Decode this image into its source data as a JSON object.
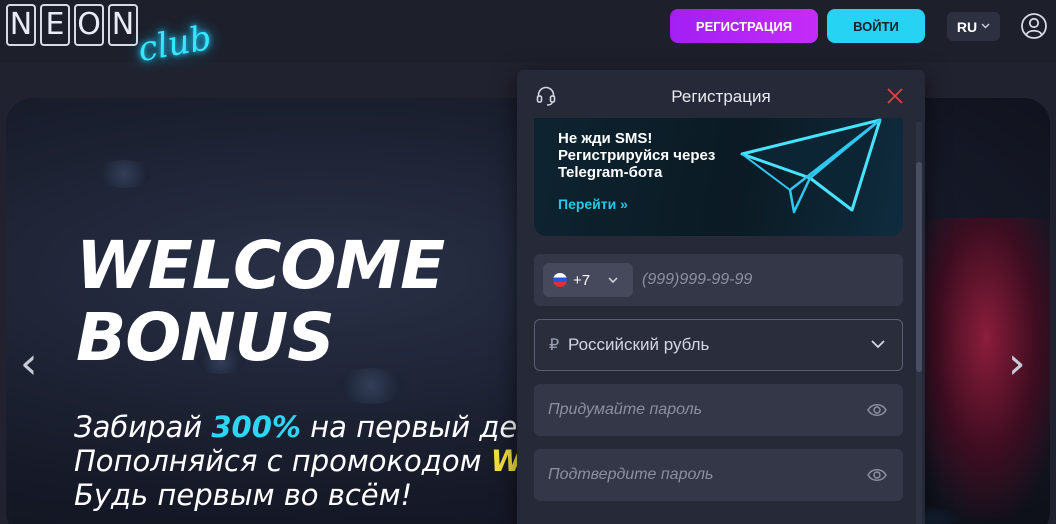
{
  "header": {
    "logo": {
      "neon": [
        "N",
        "E",
        "O",
        "N"
      ],
      "club": "club"
    },
    "register_label": "РЕГИСТРАЦИЯ",
    "login_label": "ВОЙТИ",
    "language": "RU"
  },
  "banner": {
    "headline_1": "WELCOME",
    "headline_2": "BONUS",
    "line1_a": "Забирай ",
    "line1_b": "300%",
    "line1_c": " на первый депо",
    "line2_a": "Пополняйся с промокодом ",
    "line2_b": "WE",
    "line3": "Будь первым во всём!",
    "prev_arrow": "‹",
    "next_arrow": "›"
  },
  "modal": {
    "title": "Регистрация",
    "telegram": {
      "text_1": "Не жди SMS!",
      "text_2": "Регистрируйся через",
      "text_3": "Telegram-бота",
      "link": "Перейти »"
    },
    "phone": {
      "country_code": "+7",
      "placeholder": "(999)999-99-99"
    },
    "currency": {
      "sign": "₽",
      "label": "Российский рубль"
    },
    "password_placeholder": "Придумайте пароль",
    "confirm_placeholder": "Подтвердите пароль"
  },
  "colors": {
    "register_button": "#b324f7",
    "login_button": "#27d3f2",
    "accent_cyan": "#2bd7f5",
    "accent_yellow": "#f4e13a",
    "close_icon": "#e0413f"
  },
  "icons": [
    "user-icon",
    "headset-icon",
    "close-icon",
    "chevron-down-icon",
    "eye-icon",
    "paper-plane-icon",
    "ru-flag-icon"
  ]
}
